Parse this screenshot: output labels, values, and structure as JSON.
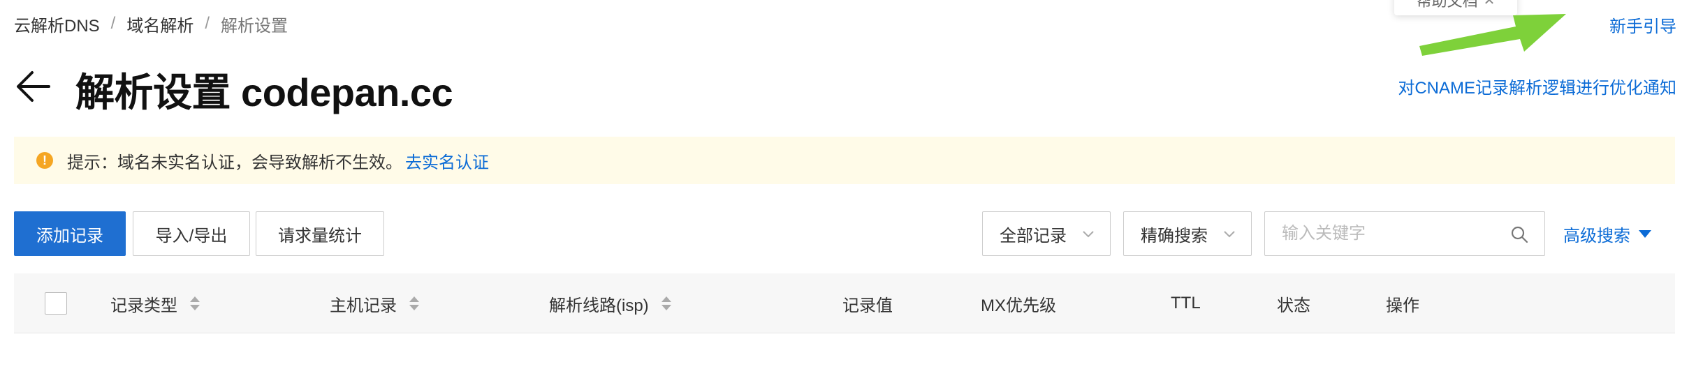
{
  "breadcrumb": {
    "items": [
      "云解析DNS",
      "域名解析",
      "解析设置"
    ],
    "separator": "/"
  },
  "help_doc": {
    "label": "帮助文档",
    "close": "✕"
  },
  "top_right": {
    "guide_link": "新手引导"
  },
  "header": {
    "title": "解析设置 codepan.cc",
    "notice_link": "对CNAME记录解析逻辑进行优化通知"
  },
  "banner": {
    "icon": "!",
    "text": "提示：域名未实名认证，会导致解析不生效。",
    "link": "去实名认证"
  },
  "toolbar": {
    "add_record": "添加记录",
    "import_export": "导入/导出",
    "request_stats": "请求量统计",
    "record_filter": "全部记录",
    "search_mode": "精确搜索",
    "search_placeholder": "输入关键字",
    "advanced_search": "高级搜索"
  },
  "table": {
    "columns": [
      "记录类型",
      "主机记录",
      "解析线路(isp)",
      "记录值",
      "MX优先级",
      "TTL",
      "状态",
      "操作"
    ]
  },
  "colors": {
    "primary": "#1f6fd1",
    "link": "#0b6bd6",
    "warning": "#f5a623",
    "banner_bg": "#fffbe8",
    "annotation_arrow": "#7ed13a"
  }
}
